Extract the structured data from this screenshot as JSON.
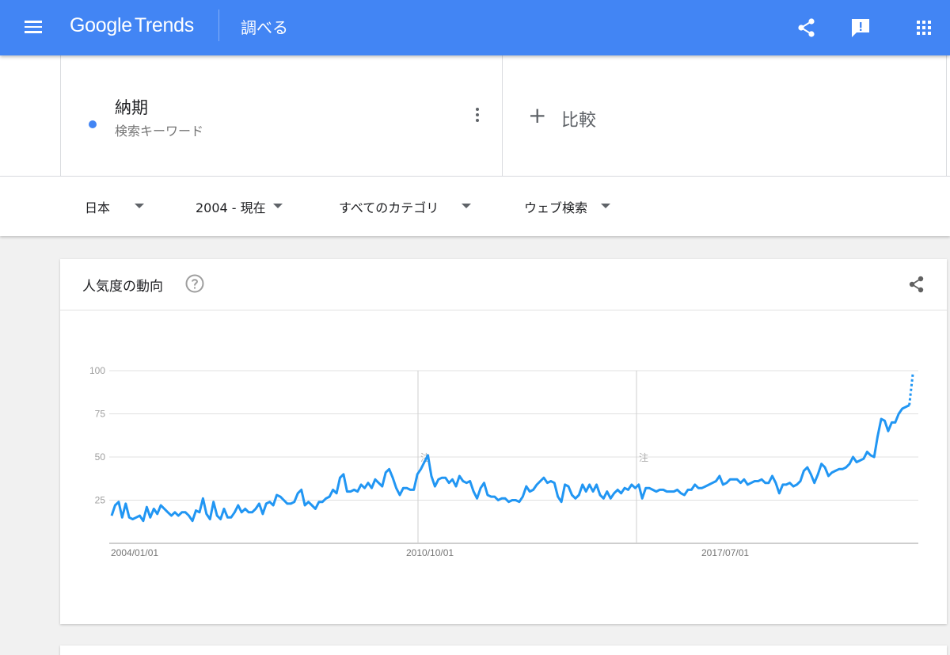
{
  "header": {
    "logo_google": "Google",
    "logo_trends": "Trends",
    "page_name": "調べる",
    "color": "#4285f4"
  },
  "search": {
    "term": "納期",
    "term_type": "検索キーワード",
    "compare_label": "比較",
    "term_color": "#4285f4"
  },
  "filters": {
    "region": "日本",
    "time": "2004 - 現在",
    "category": "すべてのカテゴリ",
    "search_type": "ウェブ検索"
  },
  "card": {
    "title": "人気度の動向"
  },
  "chart_data": {
    "type": "line",
    "y_ticks": [
      25,
      50,
      75,
      100
    ],
    "x_tick_labels": [
      "2004/01/01",
      "2010/10/01",
      "2017/07/01"
    ],
    "ylim": [
      0,
      100
    ],
    "annotation_marks": [
      "注",
      "注"
    ],
    "grid": true,
    "series": [
      {
        "color": "#2196f3",
        "x_start": "2004/01",
        "x_interval": "month",
        "values_note_partial_last": true,
        "values": [
          16,
          22,
          24,
          15,
          23,
          15,
          14,
          15,
          16,
          13,
          21,
          15,
          20,
          17,
          22,
          20,
          18,
          16,
          18,
          16,
          18,
          18,
          16,
          13,
          19,
          18,
          26,
          17,
          14,
          24,
          16,
          14,
          20,
          15,
          15,
          18,
          22,
          18,
          20,
          18,
          18,
          20,
          23,
          17,
          23,
          24,
          22,
          28,
          27,
          25,
          23,
          23,
          24,
          29,
          31,
          22,
          24,
          22,
          20,
          24,
          24,
          26,
          27,
          31,
          29,
          38,
          40,
          30,
          30,
          31,
          30,
          34,
          32,
          35,
          32,
          37,
          35,
          33,
          41,
          43,
          38,
          32,
          28,
          32,
          32,
          31,
          31,
          40,
          43,
          47,
          51,
          39,
          33,
          37,
          38,
          38,
          35,
          37,
          33,
          39,
          36,
          35,
          36,
          30,
          26,
          32,
          35,
          28,
          27,
          27,
          25,
          26,
          26,
          24,
          25,
          25,
          24,
          27,
          33,
          30,
          31,
          34,
          36,
          38,
          35,
          36,
          35,
          27,
          24,
          34,
          33,
          28,
          26,
          28,
          34,
          30,
          34,
          30,
          34,
          28,
          26,
          30,
          26,
          29,
          31,
          29,
          32,
          31,
          34,
          32,
          34,
          26,
          32,
          32,
          31,
          30,
          31,
          31,
          30,
          30,
          30,
          31,
          29,
          28,
          31,
          31,
          34,
          32,
          32,
          33,
          34,
          35,
          36,
          39,
          34,
          35,
          37,
          37,
          37,
          35,
          37,
          34,
          35,
          36,
          36,
          37,
          35,
          35,
          39,
          35,
          29,
          34,
          34,
          35,
          33,
          34,
          36,
          42,
          44,
          40,
          35,
          40,
          46,
          44,
          39,
          41,
          42,
          43,
          43,
          44,
          46,
          50,
          47,
          48,
          49,
          53,
          51,
          50,
          62,
          72,
          71,
          65,
          70,
          70,
          75,
          78,
          79,
          80,
          98
        ]
      }
    ]
  }
}
